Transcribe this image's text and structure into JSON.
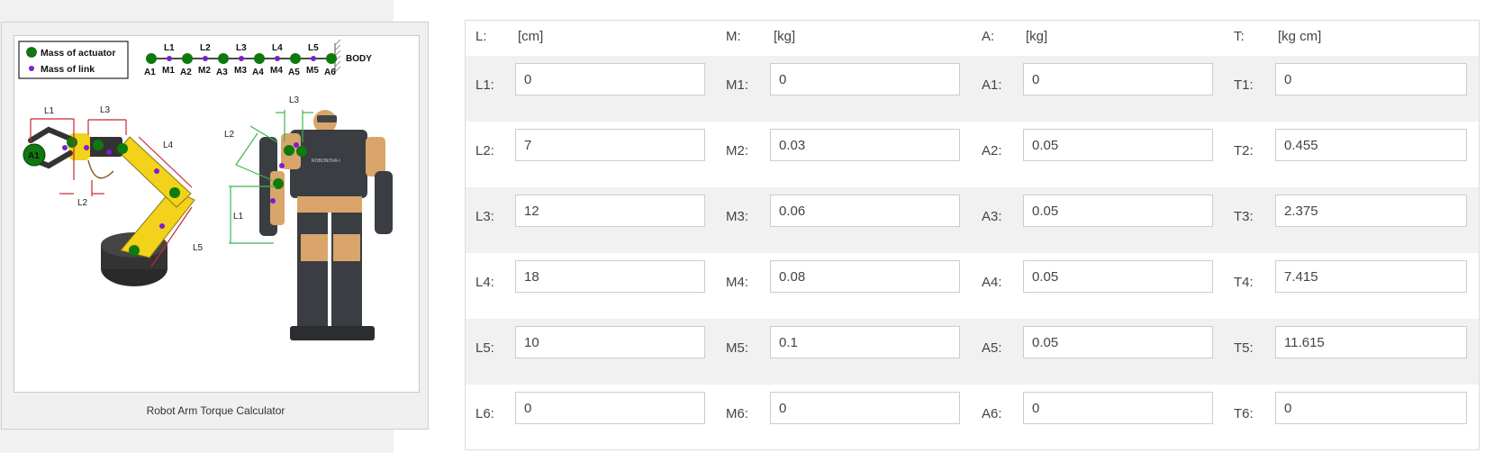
{
  "figure": {
    "caption": "Robot Arm Torque Calculator",
    "legend": {
      "actuator_label": "Mass of actuator",
      "link_label": "Mass of link"
    },
    "chain": {
      "links": [
        "L1",
        "L2",
        "L3",
        "L4",
        "L5"
      ],
      "actuators": [
        "A1",
        "A2",
        "A3",
        "A4",
        "A5",
        "A6"
      ],
      "masses": [
        "M1",
        "M2",
        "M3",
        "M4",
        "M5"
      ],
      "body_label": "BODY"
    },
    "arm_labels": [
      "L1",
      "L3",
      "L4",
      "L2",
      "L5",
      "A1"
    ],
    "humanoid_labels": [
      "L3",
      "L2",
      "L1"
    ],
    "colors": {
      "actuator": "#0e7a0e",
      "link_mass": "#7a1fd0",
      "arm_dimension": "#c8282d",
      "humanoid_dimension": "#3cb84a"
    }
  },
  "table": {
    "headers": [
      {
        "label": "L:",
        "unit": "[cm]"
      },
      {
        "label": "M:",
        "unit": "[kg]"
      },
      {
        "label": "A:",
        "unit": "[kg]"
      },
      {
        "label": "T:",
        "unit": "[kg cm]"
      }
    ],
    "rows": [
      {
        "L_label": "L1:",
        "L": "0",
        "M_label": "M1:",
        "M": "0",
        "A_label": "A1:",
        "A": "0",
        "T_label": "T1:",
        "T": "0"
      },
      {
        "L_label": "L2:",
        "L": "7",
        "M_label": "M2:",
        "M": "0.03",
        "A_label": "A2:",
        "A": "0.05",
        "T_label": "T2:",
        "T": "0.455"
      },
      {
        "L_label": "L3:",
        "L": "12",
        "M_label": "M3:",
        "M": "0.06",
        "A_label": "A3:",
        "A": "0.05",
        "T_label": "T3:",
        "T": "2.375"
      },
      {
        "L_label": "L4:",
        "L": "18",
        "M_label": "M4:",
        "M": "0.08",
        "A_label": "A4:",
        "A": "0.05",
        "T_label": "T4:",
        "T": "7.415"
      },
      {
        "L_label": "L5:",
        "L": "10",
        "M_label": "M5:",
        "M": "0.1",
        "A_label": "A5:",
        "A": "0.05",
        "T_label": "T5:",
        "T": "11.615"
      },
      {
        "L_label": "L6:",
        "L": "0",
        "M_label": "M6:",
        "M": "0",
        "A_label": "A6:",
        "A": "0",
        "T_label": "T6:",
        "T": "0"
      }
    ]
  }
}
